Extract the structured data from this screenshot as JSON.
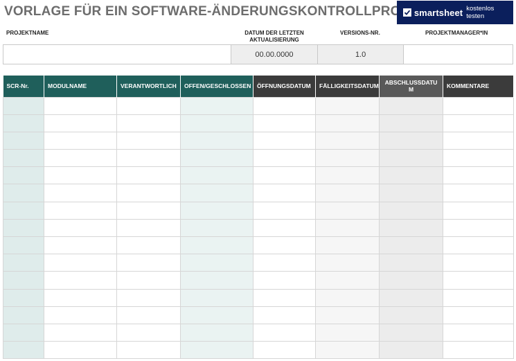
{
  "title": "VORLAGE FÜR EIN SOFTWARE-ÄNDERUNGSKONTROLLPROTOKOLL",
  "brand": {
    "name": "smartsheet",
    "cta": "kostenlos testen",
    "color": "#0b1f5c"
  },
  "info": {
    "labels": {
      "project_name": "PROJEKTNAME",
      "last_update": "DATUM DER LETZTEN AKTUALISIERUNG",
      "version": "VERSIONS-NR.",
      "project_manager": "PROJEKTMANAGER*IN"
    },
    "values": {
      "project_name": "",
      "last_update": "00.00.0000",
      "version": "1.0",
      "project_manager": ""
    }
  },
  "table": {
    "headers": [
      "SCR-Nr.",
      "MODULNAME",
      "VERANTWORTLICH",
      "OFFEN/GESCHLOSSEN",
      "ÖFFNUNGSDATUM",
      "FÄLLIGKEITSDATUM",
      "ABSCHLUSSDATUM",
      "KOMMENTARE"
    ],
    "row_count": 15,
    "colors": {
      "header_teal": "#1f5f5b",
      "header_dark": "#3b3b3b",
      "header_mid": "#595959"
    }
  }
}
